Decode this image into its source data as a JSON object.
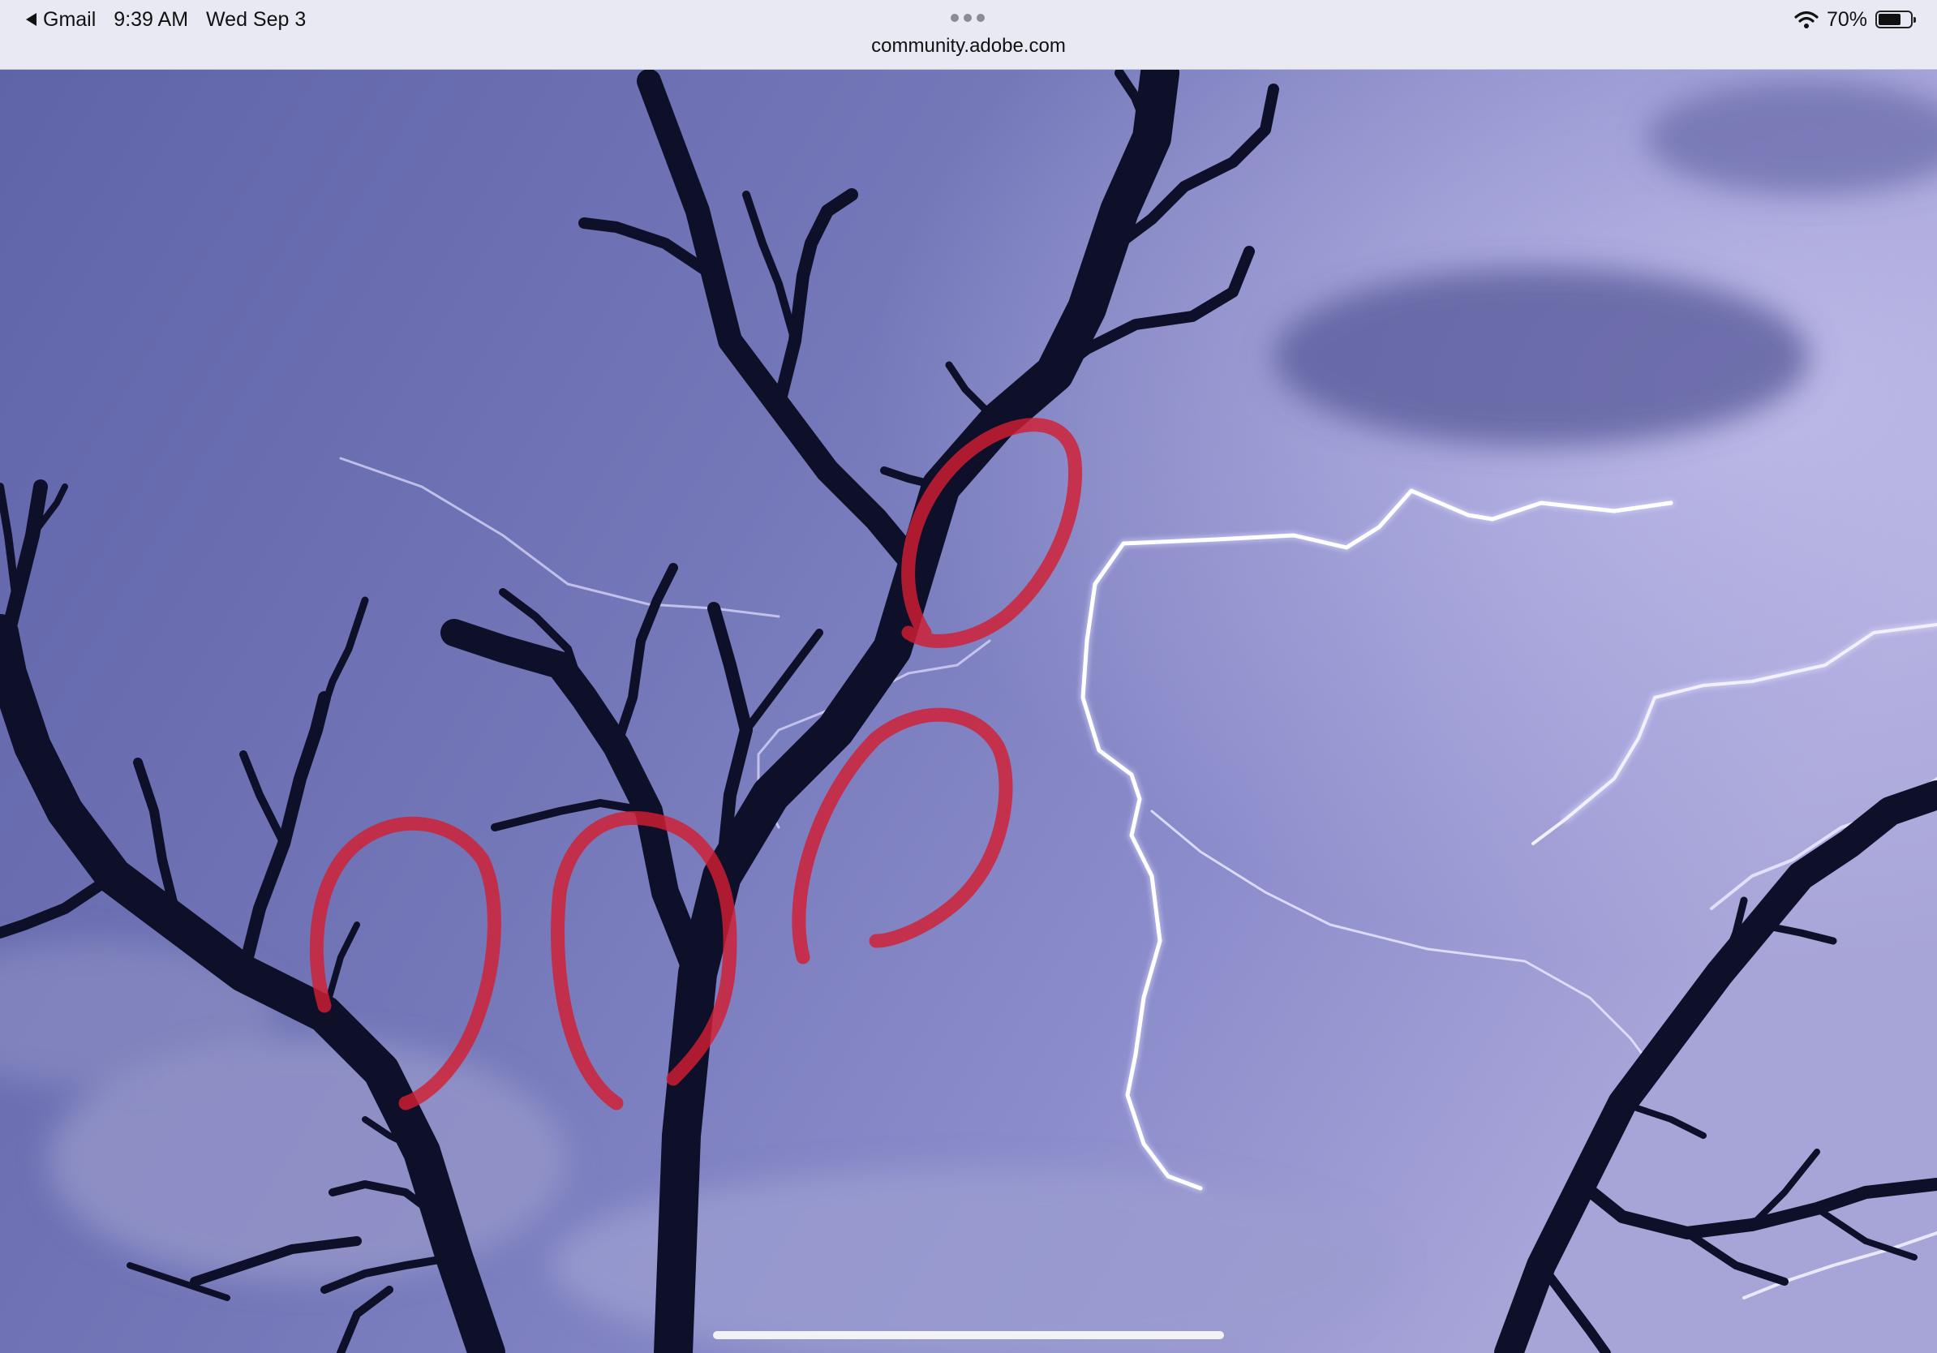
{
  "status_bar": {
    "back_app": "Gmail",
    "time": "9:39 AM",
    "date": "Wed Sep 3",
    "battery_percent": "70%",
    "battery_level": 0.7
  },
  "browser": {
    "url": "community.adobe.com"
  },
  "colors": {
    "sky": "#6a6eb0",
    "tree": "#0d1028",
    "lightning": "#f4f2ff",
    "annotation": "#d21e32"
  }
}
